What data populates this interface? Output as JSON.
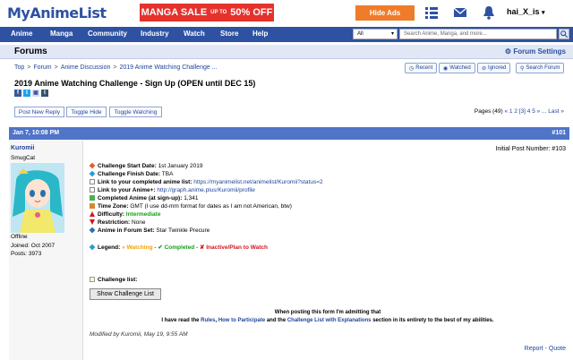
{
  "header": {
    "logo": "MyAnimeList",
    "banner_text": "MANGA SALE",
    "banner_upto": "UP TO",
    "banner_off": "50% OFF",
    "hide_ads": "Hide Ads",
    "username": "hai_X_is"
  },
  "nav": {
    "items": [
      "Anime",
      "Manga",
      "Community",
      "Industry",
      "Watch",
      "Store",
      "Help"
    ],
    "search_category": "All",
    "search_placeholder": "Search Anime, Manga, and more..."
  },
  "forums": {
    "title": "Forums",
    "settings": "Forum Settings"
  },
  "breadcrumb": [
    "Top",
    "Forum",
    "Anime Discussion",
    "2019 Anime Watching Challenge ..."
  ],
  "topic_actions": [
    "Recent",
    "Watched",
    "Ignored",
    "Search Forum"
  ],
  "topic": {
    "title": "2019 Anime Watching Challenge - Sign Up (OPEN until DEC 15)",
    "buttons": [
      "Post New Reply",
      "Toggle Hide",
      "Toggle Watching"
    ],
    "pages_label": "Pages (49)",
    "pages_links": "« 1 2 [3] 4 5 » ... Last »"
  },
  "post": {
    "date": "Jan 7, 10:08 PM",
    "number": "#101",
    "initial_post": "Initial Post Number: #103",
    "user": {
      "name": "Kuromii",
      "title": "SmugCat",
      "status": "Offline",
      "joined": "Joined: Oct 2007",
      "posts": "Posts: 3973"
    },
    "lines": [
      {
        "label": "Challenge Start Date:",
        "value": "1st January 2019"
      },
      {
        "label": "Challenge Finish Date:",
        "value": "TBA"
      },
      {
        "label": "Link to your completed anime list:",
        "value": "https://myanimelist.net/animelist/Kuromii?status=2"
      },
      {
        "label": "Link to your Anime+:",
        "value": "http://graph.anime.plus/Kuromii/profile"
      },
      {
        "label": "Completed Anime (at sign-up):",
        "value": "1,341"
      },
      {
        "label": "Time Zone:",
        "value": "GMT (I use dd-mm format for dates as I am not American, btw)"
      },
      {
        "label": "Difficulty:",
        "value": "Intermediate"
      },
      {
        "label": "Restriction:",
        "value": "None"
      },
      {
        "label": "Anime in Forum Set:",
        "value": "Star Twinkle Precure"
      }
    ],
    "legend_label": "Legend:",
    "legend_watching": "Watching",
    "legend_completed": "Completed",
    "legend_inactive": "Inactive/Plan to Watch",
    "challenge_list_label": "Challenge list:",
    "show_button": "Show Challenge List",
    "notice_line1": "When posting this form I'm admitting that",
    "notice_line2_pre": "I have read the",
    "notice_rules": "Rules",
    "notice_comma": ",",
    "notice_how": "How to Participate",
    "notice_and": "and the",
    "notice_list": "Challenge List with Explanations",
    "notice_post": "section in its entirety to the best of my abilities.",
    "modified": "Modified by Kuromii, May 19, 9:55 AM",
    "report": "Report",
    "quote": "Quote"
  },
  "colors": {
    "brand": "#2e51a2",
    "post_header": "#4f74c8",
    "forums_bar": "#e1e7f5",
    "banner": "#e5322d",
    "hide_ads": "#ef7c2a"
  }
}
